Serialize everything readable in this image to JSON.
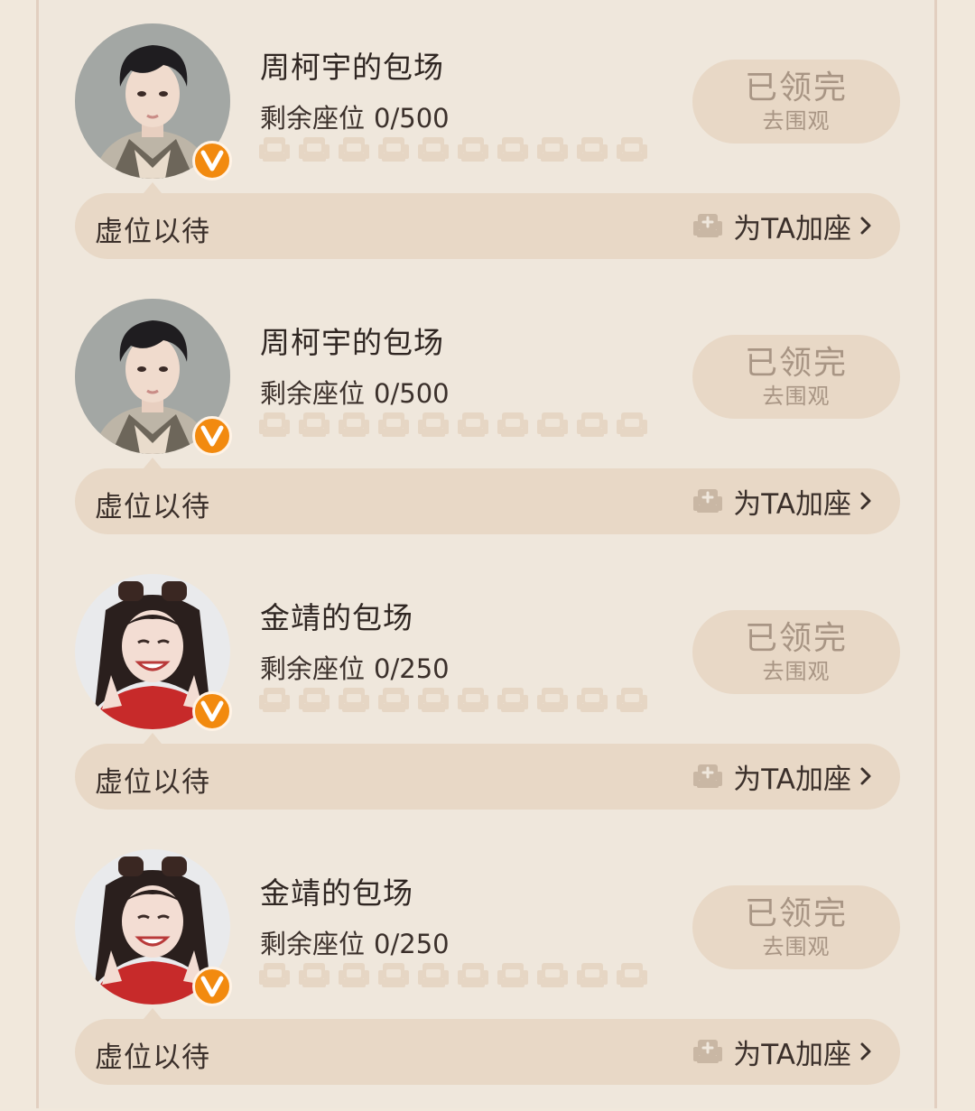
{
  "cards": [
    {
      "title": "周柯宇的包场",
      "seats_label": "剩余座位",
      "seats_count": "0/500",
      "claim_main": "已领完",
      "claim_sub": "去围观",
      "bar_label": "虚位以待",
      "add_seat_label": "为TA加座",
      "avatar_type": "male",
      "badge_icon": "v-badge-icon"
    },
    {
      "title": "周柯宇的包场",
      "seats_label": "剩余座位",
      "seats_count": "0/500",
      "claim_main": "已领完",
      "claim_sub": "去围观",
      "bar_label": "虚位以待",
      "add_seat_label": "为TA加座",
      "avatar_type": "male",
      "badge_icon": "v-badge-icon"
    },
    {
      "title": "金靖的包场",
      "seats_label": "剩余座位",
      "seats_count": "0/250",
      "claim_main": "已领完",
      "claim_sub": "去围观",
      "bar_label": "虚位以待",
      "add_seat_label": "为TA加座",
      "avatar_type": "female",
      "badge_icon": "v-badge-icon"
    },
    {
      "title": "金靖的包场",
      "seats_label": "剩余座位",
      "seats_count": "0/250",
      "claim_main": "已领完",
      "claim_sub": "去围观",
      "bar_label": "虚位以待",
      "add_seat_label": "为TA加座",
      "avatar_type": "female",
      "badge_icon": "v-badge-icon"
    }
  ],
  "colors": {
    "page_bg": "#efe7dc",
    "pill_bg": "#e8d8c6",
    "muted_text": "#a89584",
    "badge_orange": "#f28a0f"
  },
  "icons": {
    "seat": "armchair-icon",
    "add_seat": "add-seat-icon",
    "chevron": "chevron-right-icon"
  }
}
